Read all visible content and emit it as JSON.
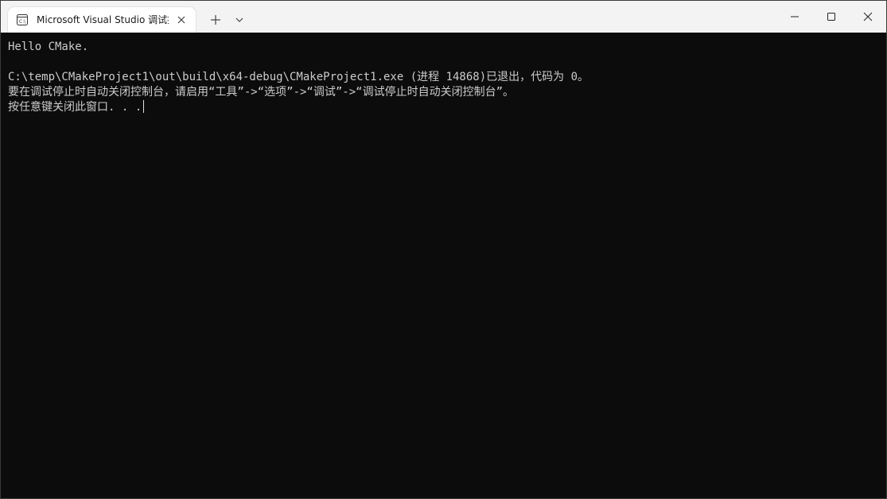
{
  "window": {
    "tab_title": "Microsoft Visual Studio 调试控制台",
    "tab_icon": "console-icon"
  },
  "titlebar": {
    "new_tab_icon": "plus-icon",
    "dropdown_icon": "chevron-down-icon",
    "minimize_icon": "minimize-icon",
    "maximize_icon": "maximize-icon",
    "close_icon": "close-icon"
  },
  "console": {
    "lines": [
      "Hello CMake.",
      "C:\\temp\\CMakeProject1\\out\\build\\x64-debug\\CMakeProject1.exe (进程 14868)已退出，代码为 0。",
      "要在调试停止时自动关闭控制台，请启用“工具”->“选项”->“调试”->“调试停止时自动关闭控制台”。",
      "按任意键关闭此窗口. . ."
    ]
  },
  "colors": {
    "console_background": "#0c0c0c",
    "console_text": "#cccccc",
    "titlebar_background": "#f3f3f3"
  }
}
